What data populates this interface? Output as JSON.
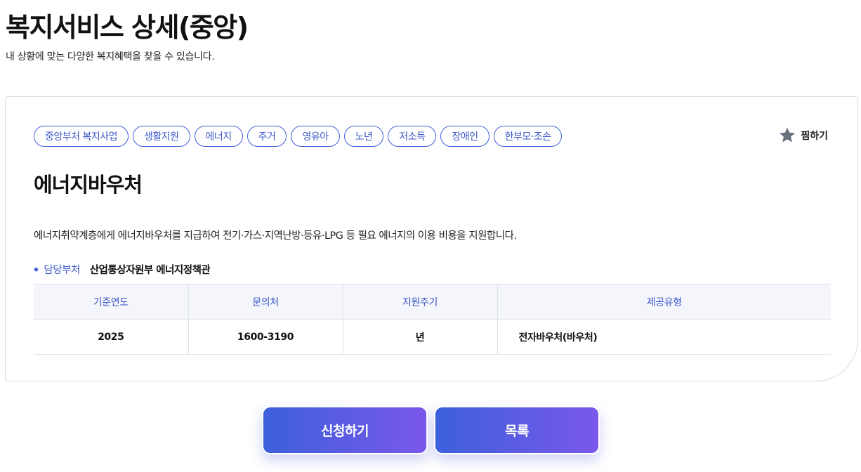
{
  "header": {
    "title": "복지서비스 상세(중앙)",
    "subtitle": "내 상황에 맞는 다양한 복지혜택을 찾을 수 있습니다."
  },
  "service": {
    "tags": [
      "중앙부처 복지사업",
      "생활지원",
      "에너지",
      "주거",
      "영유아",
      "노년",
      "저소득",
      "장애인",
      "한부모·조손"
    ],
    "favorite_label": "찜하기",
    "favorite_icon": "star-icon",
    "title": "에너지바우처",
    "description": "에너지취약계층에게 에너지바우처를 지급하여 전기·가스·지역난방·등유·LPG 등 필요 에너지의 이용 비용을 지원합니다.",
    "department_label": "담당부처",
    "department_value": "산업통상자원부 에너지정책관"
  },
  "table": {
    "headers": [
      "기준연도",
      "문의처",
      "지원주기",
      "제공유형"
    ],
    "row": [
      "2025",
      "1600-3190",
      "년",
      "전자바우처(바우처)"
    ]
  },
  "actions": {
    "apply_label": "신청하기",
    "list_label": "목록"
  },
  "colors": {
    "accent": "#3f5fd8",
    "button_gradient_start": "#3c60db",
    "button_gradient_end": "#7a58ea",
    "table_header_bg": "#f5f6fb"
  }
}
